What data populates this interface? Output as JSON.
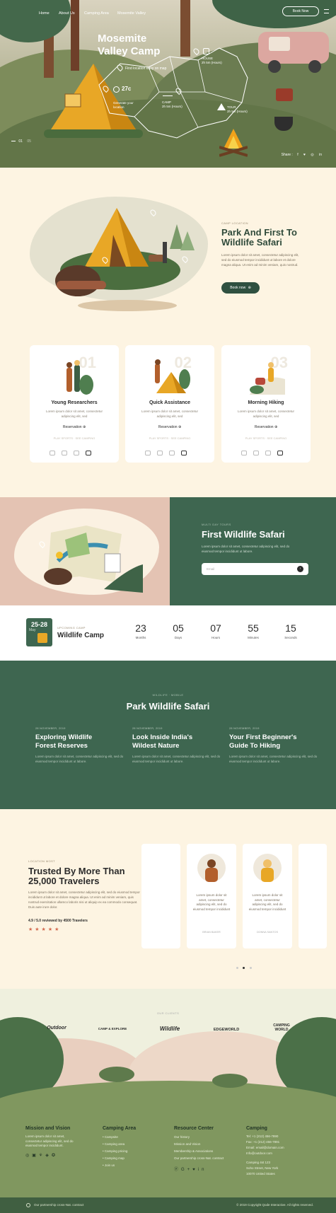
{
  "nav": {
    "items": [
      "Home",
      "About Us",
      "Camping Area",
      "Mosemite Valley"
    ],
    "book_label": "Book Now",
    "menu_icon": "menu-icon"
  },
  "hero": {
    "title_line1": "Mosemite",
    "title_line2": "Valley Camp",
    "find_location": "Find location easy on map",
    "temp": "27c",
    "temp_desc": "Generate your location",
    "spot1_title": "HOUSE",
    "spot1_value": "2h 5m (Hours)",
    "spot2_title": "CAMP",
    "spot2_value": "2h 5m (Hours)",
    "spot3_title": "TOUR",
    "spot3_value": "2h 5m (Hours)",
    "slide_current": "01",
    "slide_total": "05",
    "share_label": "Share :"
  },
  "intro": {
    "eyebrow": "CAMP LOCATION",
    "title_line1": "Park And First To",
    "title_line2": "Wildlife Safari",
    "text": "Lorem ipsum dolor sit amet, consectetur adipiscing elit, sed do eiusmod tempor incididunt ut labore et dolore magna aliqua. Ut enim ad minim veniam, quis nostrud.",
    "button": "Book now"
  },
  "cards": [
    {
      "num": "01",
      "title": "Young Researchers",
      "desc": "Lorem ipsum dolor sit amet, consectetur adipiscing elit, sed",
      "reserve": "Reservation",
      "foot": "PLAY SPORTS · SEE CAMPING"
    },
    {
      "num": "02",
      "title": "Quick Assistance",
      "desc": "Lorem ipsum dolor sit amet, consectetur adipiscing elit, sed",
      "reserve": "Reservation",
      "foot": "PLAY SPORTS · SEE CAMPING"
    },
    {
      "num": "03",
      "title": "Morning Hiking",
      "desc": "Lorem ipsum dolor sit amet, consectetur adipiscing elit, sed",
      "reserve": "Reservation",
      "foot": "PLAY SPORTS · SEE CAMPING"
    }
  ],
  "safari": {
    "eyebrow": "MULTI DAY TOURS",
    "title": "First Wildlife Safari",
    "text": "Lorem ipsum dolor sit amet, consectetur adipiscing elit, sed do eiusmod tempor incididunt ut labore.",
    "email_placeholder": "Email"
  },
  "countdown": {
    "date": "25-28",
    "month": "May",
    "eyebrow": "UPCOMING CAMP",
    "title": "Wildlife Camp",
    "units": [
      {
        "value": "23",
        "label": "Months"
      },
      {
        "value": "05",
        "label": "Days"
      },
      {
        "value": "07",
        "label": "Hours"
      },
      {
        "value": "55",
        "label": "Minutes"
      },
      {
        "value": "15",
        "label": "Seconds"
      }
    ]
  },
  "park": {
    "eyebrow": "WILDLIFE · MOBILE",
    "title": "Park Wildlife Safari",
    "posts": [
      {
        "date": "28 NOVEMBER, 2019",
        "title_line1": "Exploring Wildlife",
        "title_line2": "Forest Reserves",
        "text": "Lorem ipsum dolor sit amet, consectetur adipiscing elit, sed do eiusmod tempor incididunt ut labore."
      },
      {
        "date": "28 NOVEMBER, 2019",
        "title_line1": "Look Inside India's",
        "title_line2": "Wildest Nature",
        "text": "Lorem ipsum dolor sit amet, consectetur adipiscing elit, sed do eiusmod tempor incididunt ut labore."
      },
      {
        "date": "28 NOVEMBER, 2019",
        "title_line1": "Your First Beginner's",
        "title_line2": "Guide To Hiking",
        "text": "Lorem ipsum dolor sit amet, consectetur adipiscing elit, sed do eiusmod tempor incididunt ut labore."
      }
    ]
  },
  "trusted": {
    "eyebrow": "LOCATION MOST",
    "title_line1": "Trusted By More Than",
    "title_line2": "25,000 Travelers",
    "text": "Lorem ipsum dolor sit amet, consectetur adipiscing elit, sed do eiusmod tempor incididunt ut labore et dolore magna aliqua. Ut enim ad minim veniam, quis nostrud exercitation ullamco laboris nisi ut aliquip ex ea commodo consequat. Duis aute irure dolor.",
    "rating": "4.9 / 5.0 reviewed by 4500 Travelers",
    "testimonials": [
      {
        "text": "Lorem ipsum dolor sit amet, consectetur adipiscing elit, sed do eiusmod tempor incididunt",
        "name": "BRIAN BAKER"
      },
      {
        "text": "Lorem ipsum dolor sit amet, consectetur adipiscing elit, sed do eiusmod tempor incididunt",
        "name": "DONNA SANTOS"
      }
    ]
  },
  "logos": {
    "eyebrow": "OUR CLIENTS",
    "items": [
      "Outdoor",
      "CAMP & EXPLORE",
      "Wildlife",
      "EDGEWORLD",
      "CAMPING WORLD"
    ]
  },
  "footer": {
    "col1_title": "Mission and Vision",
    "col1_text": "Lorem ipsum dolor sit amet, consectetur adipiscing elit, sed do eiusmod tempor incididunt.",
    "col2_title": "Camping Area",
    "col2_links": [
      "Campsite",
      "Camping area",
      "Camping pricing",
      "Camping map",
      "Join us"
    ],
    "col3_title": "Resource Center",
    "col3_links": [
      "Our history",
      "Mission and Vision",
      "Membership & Associations",
      "Our partnership cross-Nat. contract"
    ],
    "col4_title": "Camping",
    "col4_lines": [
      "Tel: +1 (212) 456-7890",
      "Fax: +1 (212) 456-7891",
      "Email: email@domain.com",
      "Info@outdoor.com",
      "",
      "Camping 4st 123",
      "Soho Street, New York",
      "10070 United States"
    ],
    "bottom_left": "Our partnership cross-Nat. contract",
    "bottom_right": "© 2019 Copyright Qode Interactive. All rights reserved."
  }
}
